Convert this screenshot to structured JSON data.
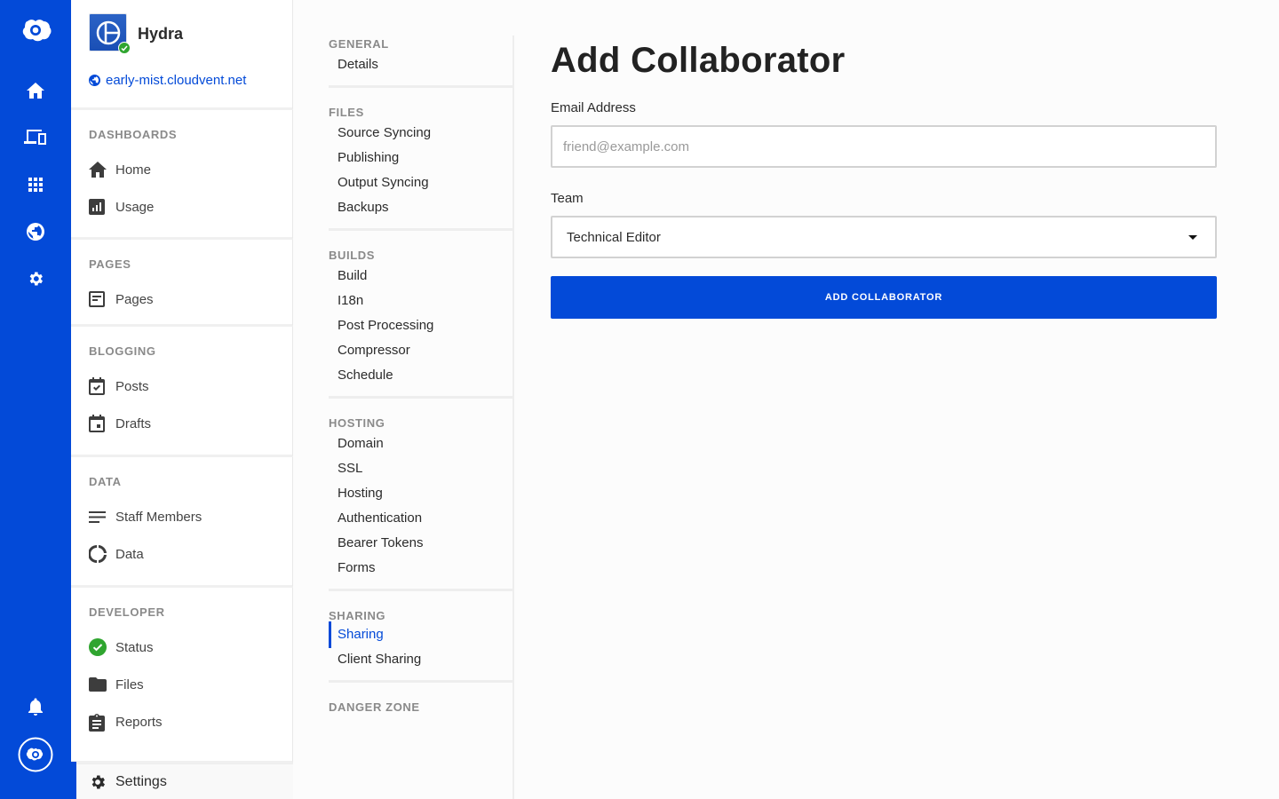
{
  "rail": {
    "icons": [
      "cloud-logo-icon",
      "home-icon",
      "devices-icon",
      "apps-grid-icon",
      "globe-icon",
      "gear-icon",
      "bell-icon",
      "account-icon"
    ]
  },
  "site": {
    "name": "Hydra",
    "url": "early-mist.cloudvent.net",
    "status": "ok"
  },
  "sidebar": {
    "sections": [
      {
        "title": "DASHBOARDS",
        "items": [
          {
            "label": "Home",
            "icon": "home-icon"
          },
          {
            "label": "Usage",
            "icon": "chart-icon"
          }
        ]
      },
      {
        "title": "PAGES",
        "items": [
          {
            "label": "Pages",
            "icon": "page-icon"
          }
        ]
      },
      {
        "title": "BLOGGING",
        "items": [
          {
            "label": "Posts",
            "icon": "calendar-check-icon"
          },
          {
            "label": "Drafts",
            "icon": "calendar-icon"
          }
        ]
      },
      {
        "title": "DATA",
        "items": [
          {
            "label": "Staff Members",
            "icon": "list-icon"
          },
          {
            "label": "Data",
            "icon": "donut-icon"
          }
        ]
      },
      {
        "title": "DEVELOPER",
        "items": [
          {
            "label": "Status",
            "icon": "check-circle-icon"
          },
          {
            "label": "Files",
            "icon": "folder-icon"
          },
          {
            "label": "Reports",
            "icon": "clipboard-icon"
          }
        ]
      }
    ],
    "settings_label": "Settings"
  },
  "settings_nav": {
    "groups": [
      {
        "title": "GENERAL",
        "items": [
          "Details"
        ]
      },
      {
        "title": "FILES",
        "items": [
          "Source Syncing",
          "Publishing",
          "Output Syncing",
          "Backups"
        ]
      },
      {
        "title": "BUILDS",
        "items": [
          "Build",
          "I18n",
          "Post Processing",
          "Compressor",
          "Schedule"
        ]
      },
      {
        "title": "HOSTING",
        "items": [
          "Domain",
          "SSL",
          "Hosting",
          "Authentication",
          "Bearer Tokens",
          "Forms"
        ]
      },
      {
        "title": "SHARING",
        "items": [
          "Sharing",
          "Client Sharing"
        ]
      },
      {
        "title": "DANGER ZONE",
        "items": []
      }
    ],
    "active": "Sharing"
  },
  "form": {
    "title": "Add Collaborator",
    "email_label": "Email Address",
    "email_value": "",
    "email_placeholder": "friend@example.com",
    "team_label": "Team",
    "team_selected": "Technical Editor",
    "submit_label": "ADD COLLABORATOR"
  },
  "colors": {
    "brand": "#034ad8",
    "success": "#2fa52f"
  }
}
